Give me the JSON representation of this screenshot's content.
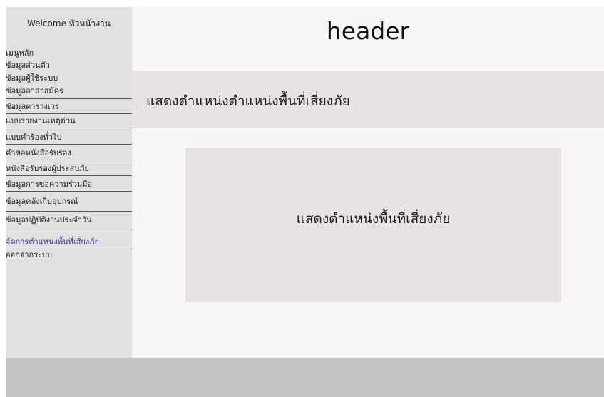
{
  "sidebar": {
    "welcome": "Welcome หัวหน้างาน",
    "items": [
      {
        "label": "เมนูหลัก"
      },
      {
        "label": "ข้อมูลส่วนตัว"
      },
      {
        "label": "ข้อมูลผู้ใช้ระบบ"
      },
      {
        "label": "ข้อมูลอาสาสมัคร"
      },
      {
        "label": "ข้อมูลตารางเวร"
      },
      {
        "label": "แบบรายงานเหตุด่วน"
      },
      {
        "label": "แบบคำร้องทั่วไป"
      },
      {
        "label": "คำขอหนังสือรับรอง"
      },
      {
        "label": "หนังสือรับรองผู้ประสบภัย"
      },
      {
        "label": "ข้อมูลการขอความร่วมมือ"
      },
      {
        "label": "ข้อมูลคลังเก็บอุปกรณ์"
      },
      {
        "label": "ข้อมูลปฏิบัติงานประจำวัน"
      },
      {
        "label": "จัดการตำแหน่งพื้นที่เสี่ยงภัย",
        "active": true
      },
      {
        "label": "ออกจากระบบ"
      }
    ]
  },
  "header": {
    "title": "header"
  },
  "main": {
    "title_bar": "แสดงตำแหน่งตำแหน่งพื้นที่เสี่ยงภัย",
    "panel_text": "แสดงตำแหน่งพื้นที่เสี่ยงภัย"
  },
  "colors": {
    "sidebar_bg": "#e2e0e0",
    "main_bg": "#f7f5f5",
    "title_bar_bg": "#e6e3e2",
    "footer_bg": "#c4c4c4",
    "active_item": "#3a3a9a"
  }
}
